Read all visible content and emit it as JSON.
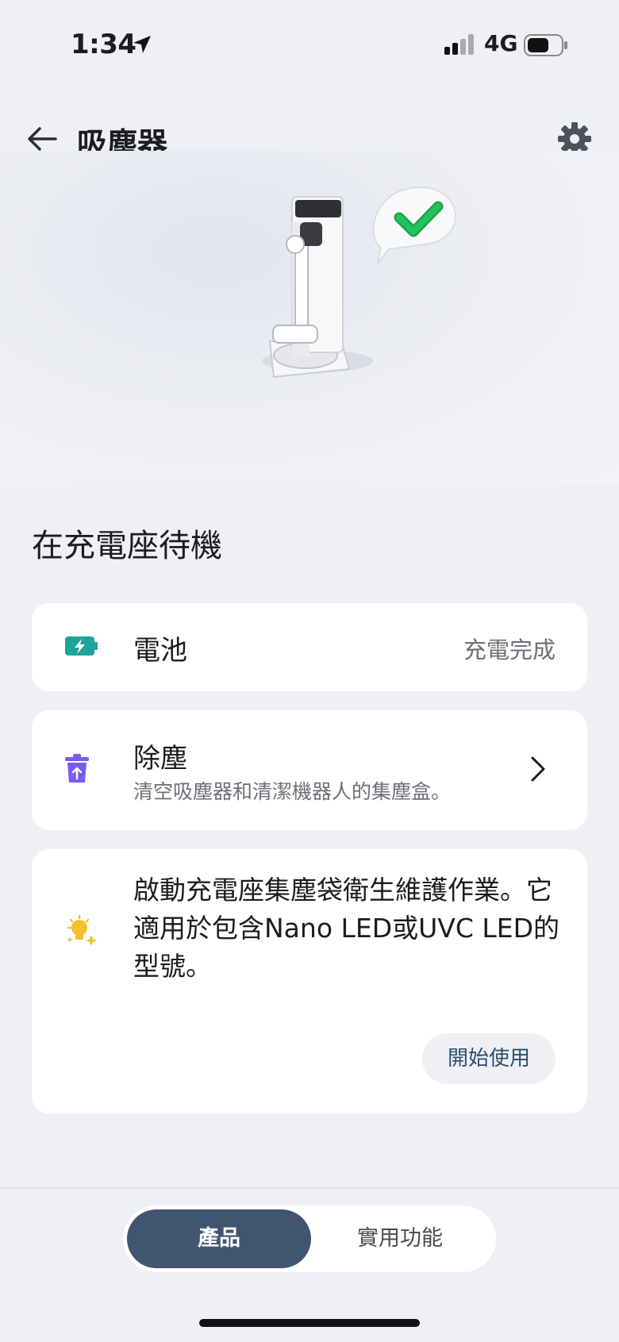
{
  "status_bar": {
    "time": "1:34",
    "network": "4G"
  },
  "header": {
    "title": "吸塵器",
    "back_icon": "arrow-left-icon",
    "settings_icon": "gear-icon"
  },
  "device": {
    "state": "在充電座待機"
  },
  "cards": {
    "battery": {
      "label": "電池",
      "value": "充電完成",
      "icon": "battery-charging-icon"
    },
    "dust": {
      "label": "除塵",
      "description": "清空吸塵器和清潔機器人的集塵盒。",
      "icon": "trash-upload-icon"
    },
    "tip": {
      "text": "啟動充電座集塵袋衛生維護作業。它適用於包含Nano LED或UVC LED的型號。",
      "button": "開始使用",
      "icon": "bulb-sparkle-icon"
    }
  },
  "tabs": [
    {
      "label": "產品",
      "active": true
    },
    {
      "label": "實用功能",
      "active": false
    }
  ],
  "colors": {
    "accent": "#415470",
    "battery": "#1fa39a",
    "dust_icon": "#7a5cf0",
    "tip_icon": "#f5c02e",
    "check": "#22c25d"
  }
}
